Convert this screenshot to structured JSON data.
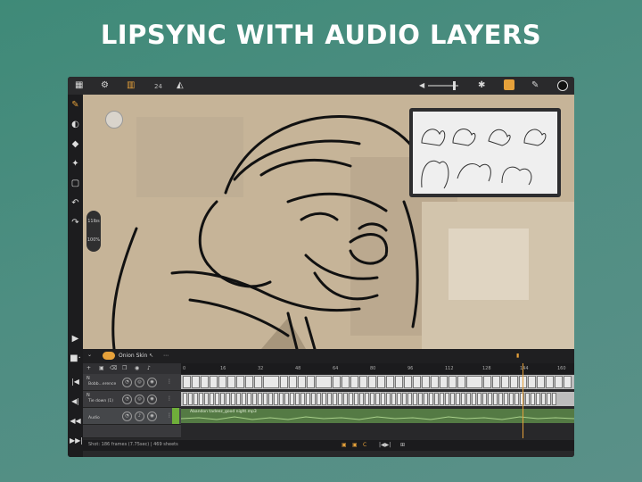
{
  "headline": "LIPSYNC WITH AUDIO LAYERS",
  "toolbar": {
    "grid_icon": "grid-icon",
    "settings_icon": "gear-icon",
    "fps": "24",
    "volume_icon": "speaker-icon",
    "volume_level": 0.82,
    "accent": "#e6a13a"
  },
  "canvas": {
    "brush_slider_top": "11lbs",
    "brush_slider_bottom": "100%"
  },
  "onion": {
    "label": "Onion Skin",
    "enabled": true
  },
  "timeline": {
    "ruler_ticks": [
      "0",
      "16",
      "32",
      "48",
      "64",
      "80",
      "96",
      "112",
      "128",
      "144",
      "160"
    ],
    "layers": [
      {
        "flag": "N",
        "name": "Bobb...erence"
      },
      {
        "flag": "N",
        "name": "Tie down (1)"
      },
      {
        "flag": "",
        "name": "Audio"
      }
    ],
    "audio_clip_label": "Abandon tadeez_good night.mp3",
    "status": "Shot: 186 frames (7.75sec) | 469 sheets"
  }
}
